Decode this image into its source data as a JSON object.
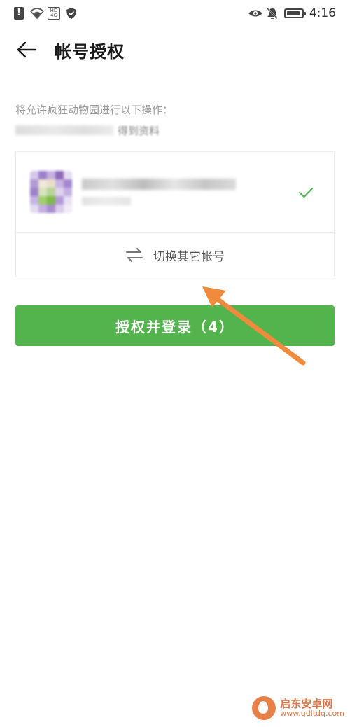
{
  "status_bar": {
    "time": "4:16",
    "icons": [
      "alert-icon",
      "wifi-icon",
      "hd-box-icon",
      "shield-icon",
      "eye-icon",
      "mute-bell-icon",
      "battery-icon"
    ]
  },
  "nav": {
    "back_icon": "arrow-left-icon",
    "title": "帐号授权"
  },
  "permission": {
    "intro": "将允许疯狂动物园进行以下操作：",
    "item_visible_text": "得到资料"
  },
  "account_card": {
    "selected": true,
    "check_color": "#53b44d",
    "switch_label": "切换其它帐号"
  },
  "login_button": {
    "label": "授权并登录（4）",
    "color": "#53b44d"
  },
  "annotation": {
    "arrow_color": "#f08a3c"
  },
  "watermark": {
    "text_cn": "启东安卓网",
    "url": "www.qdltdq.com"
  }
}
